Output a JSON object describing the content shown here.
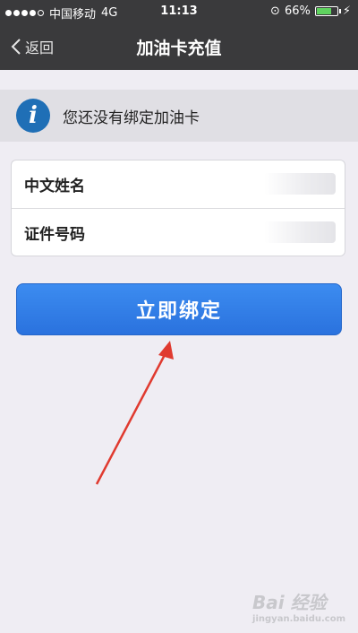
{
  "status_bar": {
    "carrier": "中国移动",
    "network": "4G",
    "time": "11:13",
    "battery": "66%",
    "battery_level": 0.66
  },
  "nav": {
    "back_label": "返回",
    "title": "加油卡充值"
  },
  "notice": {
    "text": "您还没有绑定加油卡"
  },
  "form": {
    "name_label": "中文姓名",
    "id_label": "证件号码"
  },
  "actions": {
    "bind_label": "立即绑定"
  },
  "watermark": {
    "text": "Bai 经验",
    "sub": "jingyan.baidu.com"
  },
  "colors": {
    "nav_bg": "#3a3a3c",
    "accent": "#2a72de",
    "arrow": "#e03a2f"
  }
}
